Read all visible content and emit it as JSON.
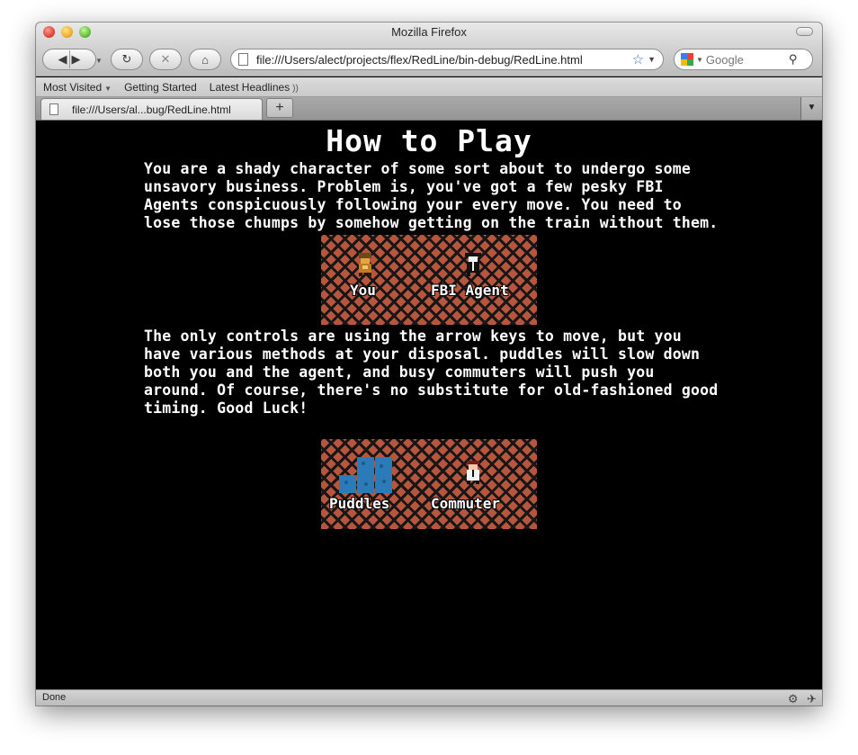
{
  "window": {
    "title": "Mozilla Firefox"
  },
  "toolbar": {
    "back_icon": "◀",
    "forward_icon": "▶",
    "reload_icon": "↻",
    "stop_icon": "✕",
    "home_icon": "⌂",
    "url": "file:///Users/alect/projects/flex/RedLine/bin-debug/RedLine.html",
    "search_placeholder": "Google"
  },
  "bookmarks": {
    "items": [
      {
        "label": "Most Visited"
      },
      {
        "label": "Getting Started"
      },
      {
        "label": "Latest Headlines"
      }
    ]
  },
  "tabs": {
    "active_label": "file:///Users/al...bug/RedLine.html",
    "new_tab_label": "+"
  },
  "page": {
    "heading": "How to Play",
    "intro": "You are a shady character of some sort about to undergo some unsavory business. Problem is, you've got a few pesky FBI Agents conspicuously following your every move. You need to lose those chumps by somehow getting on the train without them.",
    "controls": "The only controls are using the arrow keys to move, but you have various methods at your disposal. puddles will slow down both you and the agent, and busy commuters will push you around. Of course, there's no substitute for old-fashioned good timing. Good Luck!",
    "figure1": {
      "you_label": "You",
      "agent_label": "FBI Agent"
    },
    "figure2": {
      "puddles_label": "Puddles",
      "commuter_label": "Commuter"
    }
  },
  "status": {
    "text": "Done"
  },
  "colors": {
    "tile_red": "#b8553d",
    "puddle_blue": "#2a7bb8",
    "background": "#000000"
  }
}
